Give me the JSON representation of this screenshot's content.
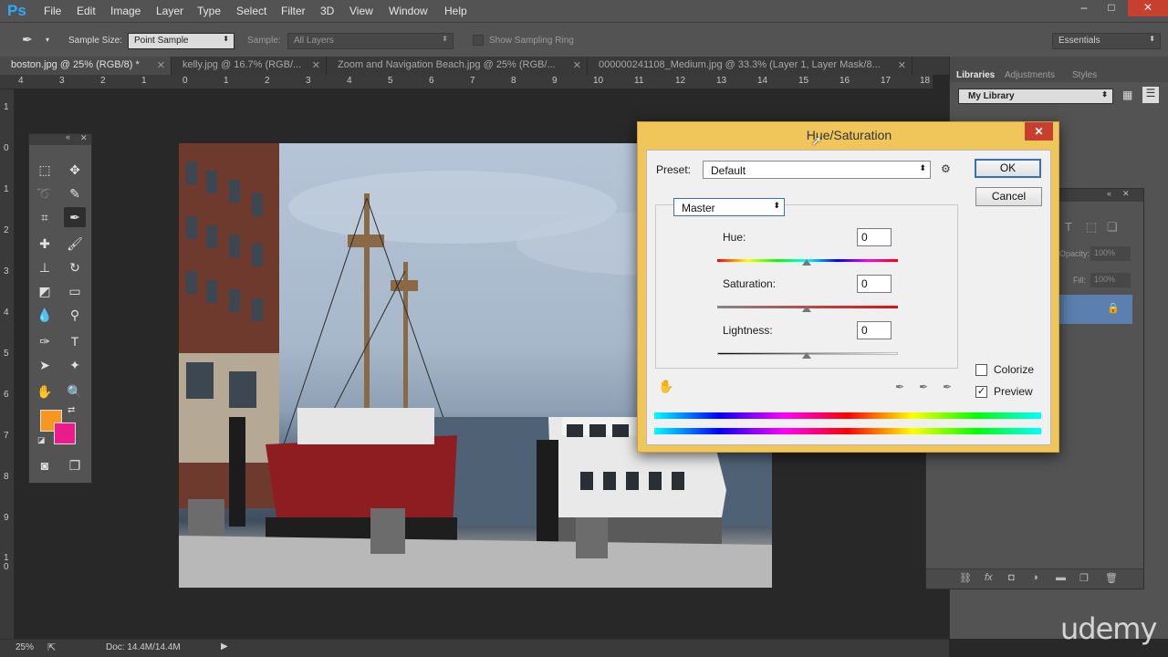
{
  "app": {
    "logo": "Ps"
  },
  "menu": [
    "File",
    "Edit",
    "Image",
    "Layer",
    "Type",
    "Select",
    "Filter",
    "3D",
    "View",
    "Window",
    "Help"
  ],
  "window_controls": {
    "minimize": "–",
    "maximize": "□",
    "close": "✕"
  },
  "options": {
    "sample_size_label": "Sample Size:",
    "sample_size_value": "Point Sample",
    "sample_label": "Sample:",
    "sample_value": "All Layers",
    "show_ring_label": "Show Sampling Ring",
    "workspace": "Essentials"
  },
  "tabs": [
    {
      "label": "boston.jpg @ 25% (RGB/8) *"
    },
    {
      "label": "kelly.jpg @ 16.7% (RGB/..."
    },
    {
      "label": "Zoom and Navigation Beach.jpg @ 25% (RGB/..."
    },
    {
      "label": "000000241108_Medium.jpg @ 33.3% (Layer 1, Layer Mask/8..."
    }
  ],
  "ruler_top": [
    "4",
    "3",
    "2",
    "1",
    "0",
    "1",
    "2",
    "3",
    "4",
    "5",
    "6",
    "7",
    "8",
    "9",
    "10",
    "11",
    "12",
    "13",
    "14",
    "15",
    "16",
    "17",
    "18"
  ],
  "ruler_left": [
    "1",
    "0",
    "1",
    "2",
    "3",
    "4",
    "5",
    "6",
    "7",
    "8",
    "9",
    "1 0"
  ],
  "right_panel": {
    "tabs": [
      "Libraries",
      "Adjustments",
      "Styles"
    ],
    "library": "My Library",
    "opacity_label": "Opacity:",
    "opacity_value": "100%",
    "fill_label": "Fill:",
    "fill_value": "100%"
  },
  "status": {
    "zoom": "25%",
    "doc": "Doc: 14.4M/14.4M"
  },
  "watermark": "udemy",
  "dialog": {
    "title": "Hue/Saturation",
    "preset_label": "Preset:",
    "preset_value": "Default",
    "ok": "OK",
    "cancel": "Cancel",
    "channel": "Master",
    "hue_label": "Hue:",
    "hue_value": "0",
    "saturation_label": "Saturation:",
    "saturation_value": "0",
    "lightness_label": "Lightness:",
    "lightness_value": "0",
    "colorize_label": "Colorize",
    "preview_label": "Preview",
    "colorize_checked": false,
    "preview_checked": true
  },
  "colors": {
    "foreground": "#f6981f",
    "background": "#ec1b8c",
    "dialog_frame": "#f0c65a"
  }
}
